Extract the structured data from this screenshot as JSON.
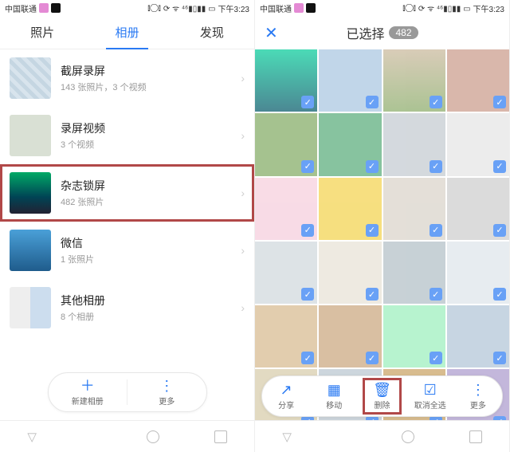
{
  "status": {
    "carrier": "中国联通",
    "indicators": "⟳ ᯤ ⁴⁶▮▯▮▮ ▭",
    "vibrate_icon": "⫾◯⫾",
    "time": "下午3:23"
  },
  "left": {
    "tabs": {
      "photos": "照片",
      "albums": "相册",
      "discover": "发现",
      "active_index": 1
    },
    "albums": [
      {
        "name": "截屏录屏",
        "sub": "143 张照片，3 个视频",
        "thumb_class": "t-grid",
        "highlighted": false
      },
      {
        "name": "录屏视频",
        "sub": "3 个视频",
        "thumb_class": "t-paper",
        "highlighted": false
      },
      {
        "name": "杂志锁屏",
        "sub": "482 张照片",
        "thumb_class": "t-aurora",
        "highlighted": true
      },
      {
        "name": "微信",
        "sub": "1 张照片",
        "thumb_class": "t-sea",
        "highlighted": false
      },
      {
        "name": "其他相册",
        "sub": "8 个相册",
        "thumb_class": "t-collage",
        "highlighted": false
      }
    ],
    "pill": {
      "new_album": "新建相册",
      "more": "更多"
    }
  },
  "right": {
    "title": "已选择",
    "count": "482",
    "grid_count": 24,
    "actions": {
      "share": "分享",
      "move": "移动",
      "delete": "删除",
      "deselect_all": "取消全选",
      "more": "更多",
      "highlighted": "delete"
    }
  }
}
